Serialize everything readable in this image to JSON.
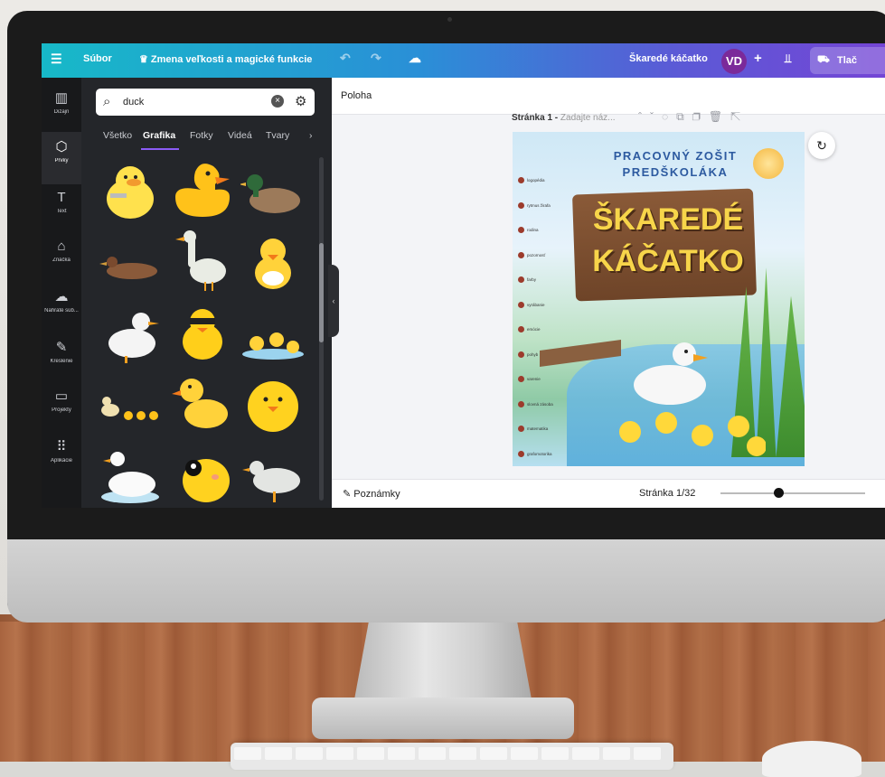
{
  "topbar": {
    "menu_icon": "hamburger-icon",
    "file_label": "Súbor",
    "resize_label": "Zmena veľkosti a magické funkcie",
    "undo_icon": "undo-icon",
    "redo_icon": "redo-icon",
    "cloud_icon": "cloud-check-icon",
    "doc_title": "Škaredé káčatko",
    "avatar_initials": "VD",
    "print_label": "Tlač"
  },
  "rail": {
    "items": [
      {
        "label": "Dizajn",
        "icon": "layout-icon"
      },
      {
        "label": "Prvky",
        "icon": "shapes-icon"
      },
      {
        "label": "Text",
        "icon": "text-icon"
      },
      {
        "label": "Značka",
        "icon": "brand-icon"
      },
      {
        "label": "Nahraté súb...",
        "icon": "cloud-upload-icon"
      },
      {
        "label": "Kreslenie",
        "icon": "pen-icon"
      },
      {
        "label": "Projekty",
        "icon": "folder-icon"
      },
      {
        "label": "Aplikácie",
        "icon": "apps-grid-icon"
      }
    ],
    "active_index": 1
  },
  "panel": {
    "search_value": "duck",
    "tabs": [
      "Všetko",
      "Grafika",
      "Fotky",
      "Videá",
      "Tvary"
    ],
    "active_tab": "Grafika",
    "scroll_fraction": 0.35
  },
  "canvas": {
    "position_label": "Poloha",
    "page_label": "Stránka 1 -",
    "page_title_placeholder": "Zadajte náz...",
    "notes_label": "Poznámky",
    "page_counter": "Stránka 1/32",
    "zoom_fraction": 0.4
  },
  "book": {
    "title_line1": "PRACOVNÝ ZOŠIT",
    "title_line2": "PREDŠKOLÁKA",
    "big_line1": "ŠKAREDÉ",
    "big_line2": "KÁČATKO",
    "toc": [
      "logopédia",
      "rytmus žirafa",
      "rodina",
      "pozornosť",
      "farby",
      "vyrábanie",
      "emócie",
      "pohyb",
      "varenie",
      "slovná zásoba",
      "matematika",
      "grafomotorika"
    ]
  },
  "colors": {
    "topbar_start": "#17b9c8",
    "topbar_end": "#7445d5",
    "panel_bg": "#24262a",
    "accent": "#8b5cf6"
  }
}
